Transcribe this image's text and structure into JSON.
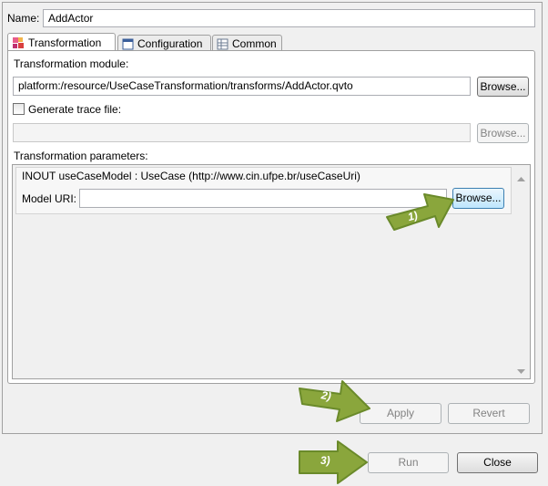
{
  "name": {
    "label": "Name:",
    "value": "AddActor"
  },
  "tabs": [
    {
      "label": "Transformation",
      "icon": "transformation-icon"
    },
    {
      "label": "Configuration",
      "icon": "configuration-icon"
    },
    {
      "label": "Common",
      "icon": "common-icon"
    }
  ],
  "module": {
    "label": "Transformation module:",
    "value": "platform:/resource/UseCaseTransformation/transforms/AddActor.qvto",
    "browse": "Browse..."
  },
  "trace": {
    "label": "Generate trace file:",
    "checked": false,
    "value": "",
    "browse": "Browse..."
  },
  "params": {
    "label": "Transformation parameters:",
    "header": "INOUT  useCaseModel : UseCase (http://www.cin.ufpe.br/useCaseUri)",
    "uri_label": "Model URI:",
    "uri_value": "",
    "browse": "Browse..."
  },
  "actions": {
    "apply": "Apply",
    "revert": "Revert"
  },
  "footer": {
    "run": "Run",
    "close": "Close"
  },
  "annotations": [
    "1)",
    "2)",
    "3)"
  ],
  "colors": {
    "arrow_fill": "#8aa63c",
    "arrow_stroke": "#6a8a2a",
    "hot_button": "#bee6fd"
  }
}
